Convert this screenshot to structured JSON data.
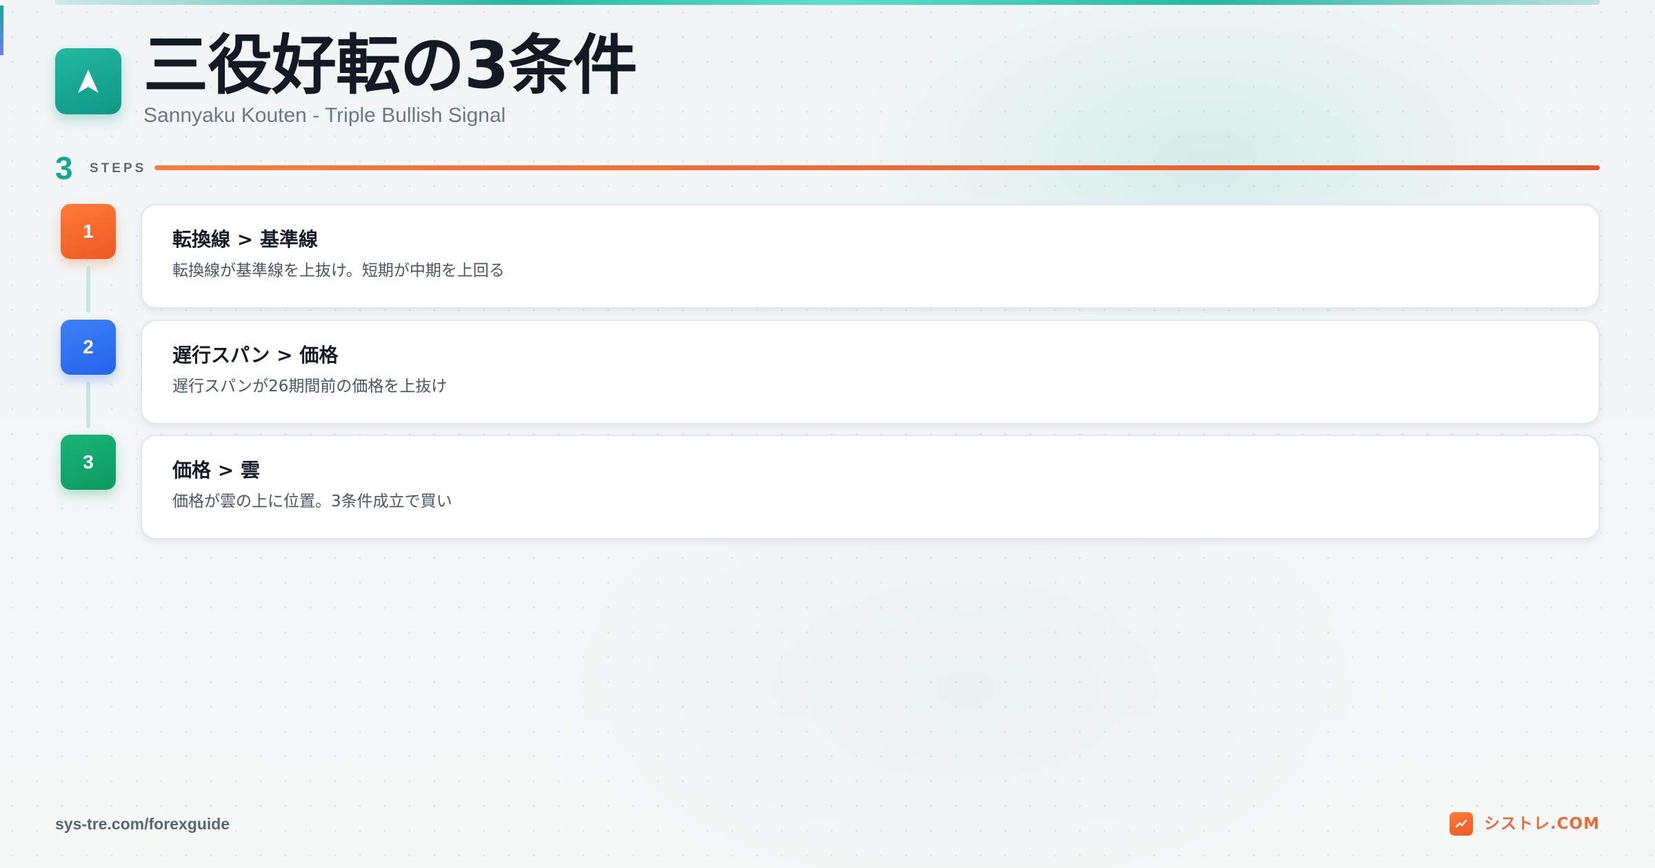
{
  "header": {
    "icon": "navigation-arrow-icon",
    "title": "三役好転の3条件",
    "subtitle": "Sannyaku Kouten - Triple Bullish Signal"
  },
  "steps_header": {
    "count": "3",
    "label": "STEPS"
  },
  "steps": [
    {
      "number": "1",
      "title": "転換線 > 基準線",
      "description": "転換線が基準線を上抜け。短期が中期を上回る",
      "color": "#f26a2e"
    },
    {
      "number": "2",
      "title": "遅行スパン > 価格",
      "description": "遅行スパンが26期間前の価格を上抜け",
      "color": "#2f6ff0"
    },
    {
      "number": "3",
      "title": "価格 > 雲",
      "description": "価格が雲の上に位置。3条件成立で買い",
      "color": "#12a86c"
    }
  ],
  "footer": {
    "url": "sys-tre.com/forexguide",
    "brand_icon": "trend-chart-icon",
    "brand": "シストレ.COM"
  },
  "colors": {
    "accent_teal": "#14a893",
    "accent_orange": "#f26a33",
    "title_text": "#141a24"
  }
}
